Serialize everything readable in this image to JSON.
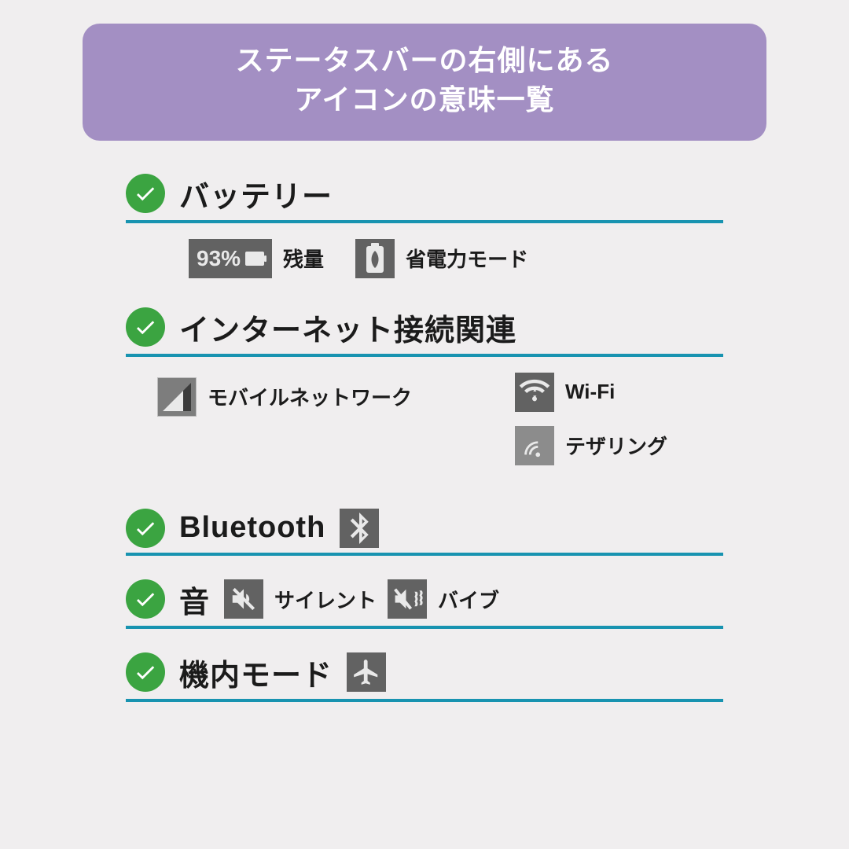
{
  "header": {
    "line1": "ステータスバーの右側にある",
    "line2": "アイコンの意味一覧"
  },
  "sections": {
    "battery": {
      "title": "バッテリー",
      "items": {
        "level": {
          "value": "93%",
          "label": "残量"
        },
        "saver": {
          "label": "省電力モード"
        }
      }
    },
    "internet": {
      "title": "インターネット接続関連",
      "items": {
        "mobile": {
          "label": "モバイルネットワーク"
        },
        "wifi": {
          "label": "Wi-Fi"
        },
        "tether": {
          "label": "テザリング"
        }
      }
    },
    "bluetooth": {
      "title": "Bluetooth"
    },
    "sound": {
      "title": "音",
      "items": {
        "silent": {
          "label": "サイレント"
        },
        "vibrate": {
          "label": "バイブ"
        }
      }
    },
    "airplane": {
      "title": "機内モード"
    }
  },
  "colors": {
    "accent": "#1893b0",
    "check": "#3ba441",
    "header_bg": "#a38fc3"
  }
}
